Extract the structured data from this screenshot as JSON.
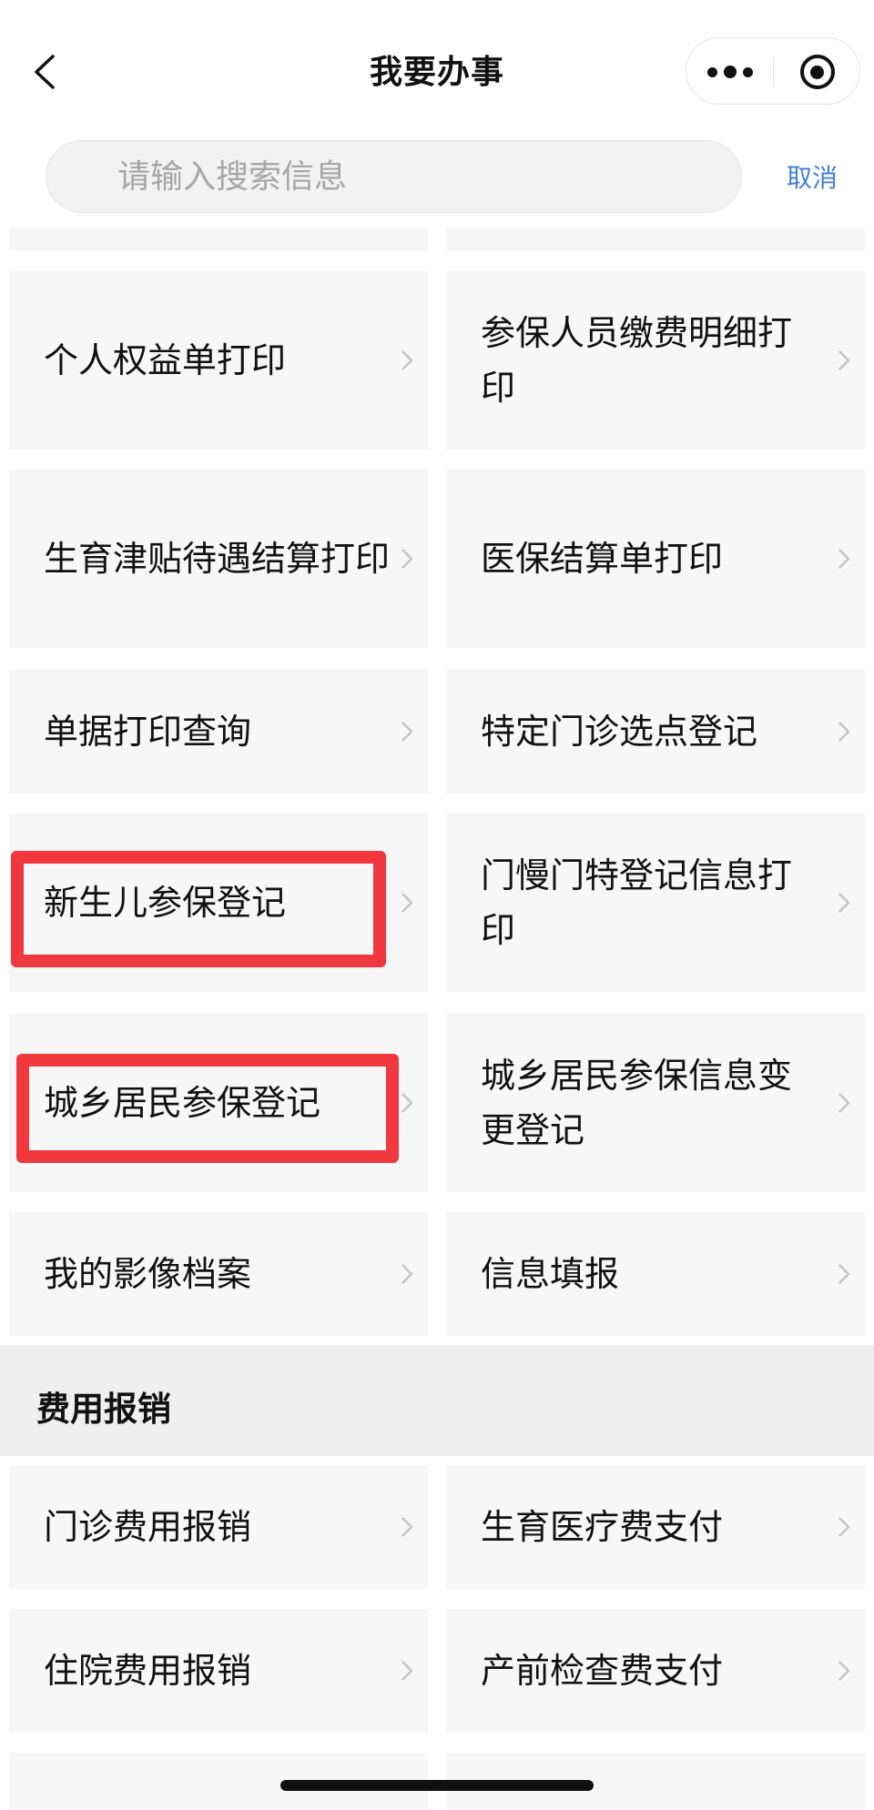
{
  "nav": {
    "title": "我要办事"
  },
  "search": {
    "placeholder": "请输入搜索信息",
    "value": "",
    "cancel_label": "取消"
  },
  "services": {
    "row1": {
      "left": "个人权益单打印",
      "right": "参保人员缴费明细打印"
    },
    "row2": {
      "left": "生育津贴待遇结算打印",
      "right": "医保结算单打印"
    },
    "row3": {
      "left": "单据打印查询",
      "right": "特定门诊选点登记"
    },
    "row4": {
      "left": "新生儿参保登记",
      "right": "门慢门特登记信息打印"
    },
    "row5": {
      "left": "城乡居民参保登记",
      "right": "城乡居民参保信息变更登记"
    },
    "row6": {
      "left": "我的影像档案",
      "right": "信息填报"
    }
  },
  "expense_section": {
    "title": "费用报销",
    "row1": {
      "left": "门诊费用报销",
      "right": "生育医疗费支付"
    },
    "row2": {
      "left": "住院费用报销",
      "right": "产前检查费支付"
    }
  },
  "highlight_color": "#f2383f",
  "accent_color": "#3f7fd8",
  "icons": [
    "chevron-left-icon",
    "more-dots-icon",
    "target-icon",
    "chevron-right-icon"
  ]
}
